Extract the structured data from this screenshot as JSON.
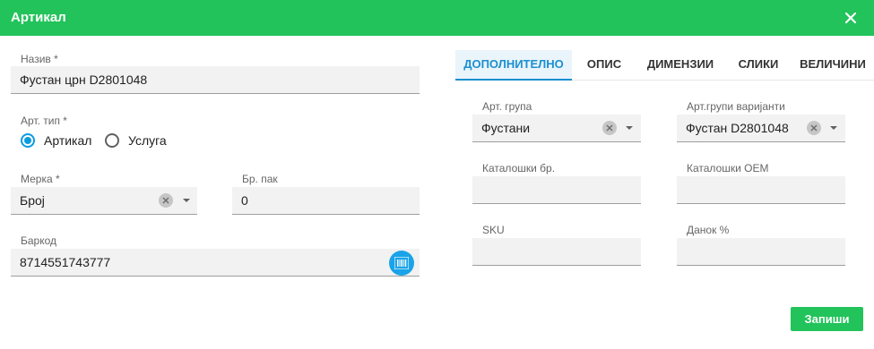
{
  "header": {
    "title": "Артикал",
    "close_icon": "close-icon",
    "color": "#21c35a"
  },
  "left": {
    "name": {
      "label": "Назив *",
      "value": "Фустан црн D2801048"
    },
    "type": {
      "label": "Арт. тип *",
      "options": [
        {
          "label": "Артикал",
          "selected": true
        },
        {
          "label": "Услуга",
          "selected": false
        }
      ]
    },
    "unit": {
      "label": "Мерка *",
      "value": "Број"
    },
    "pack_count": {
      "label": "Бр. пак",
      "value": "0"
    },
    "barcode": {
      "label": "Баркод",
      "value": "8714551743777",
      "icon": "barcode-icon"
    }
  },
  "tabs": [
    {
      "label": "ДОПОЛНИТЕЛНО",
      "active": true
    },
    {
      "label": "ОПИС",
      "active": false
    },
    {
      "label": "ДИМЕНЗИИ",
      "active": false
    },
    {
      "label": "СЛИКИ",
      "active": false
    },
    {
      "label": "ВЕЛИЧИНИ",
      "active": false
    }
  ],
  "extra": {
    "art_group": {
      "label": "Арт. група",
      "value": "Фустани"
    },
    "variant_groups": {
      "label": "Арт.групи варијанти",
      "value": "Фустан D2801048"
    },
    "catalog_no": {
      "label": "Каталошки бр.",
      "value": ""
    },
    "catalog_oem": {
      "label": "Каталошки OEM",
      "value": ""
    },
    "sku": {
      "label": "SKU",
      "value": ""
    },
    "tax": {
      "label": "Данок %",
      "value": ""
    }
  },
  "footer": {
    "save_label": "Запиши"
  },
  "colors": {
    "accent": "#21c35a",
    "primary_blue": "#1a8fd0"
  }
}
